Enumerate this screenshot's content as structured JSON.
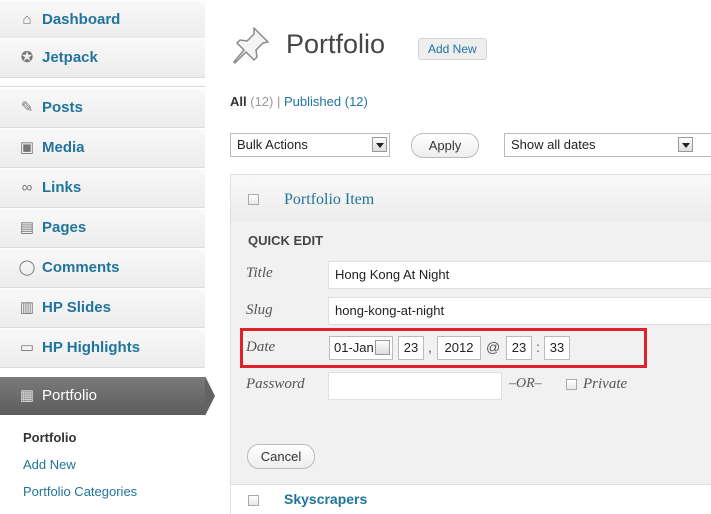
{
  "sidebar": {
    "items": [
      {
        "label": "Dashboard",
        "icon": "home-icon"
      },
      {
        "label": "Jetpack",
        "icon": "jetpack-icon"
      },
      {
        "label": "Posts",
        "icon": "pin-icon"
      },
      {
        "label": "Media",
        "icon": "media-icon"
      },
      {
        "label": "Links",
        "icon": "link-icon"
      },
      {
        "label": "Pages",
        "icon": "pages-icon"
      },
      {
        "label": "Comments",
        "icon": "comment-icon"
      },
      {
        "label": "HP Slides",
        "icon": "slides-icon"
      },
      {
        "label": "HP Highlights",
        "icon": "highlights-icon"
      },
      {
        "label": "Portfolio",
        "icon": "portfolio-icon"
      }
    ],
    "submenu": [
      "Portfolio",
      "Add New",
      "Portfolio Categories"
    ]
  },
  "header": {
    "title": "Portfolio",
    "add_new": "Add New"
  },
  "filters": {
    "all_label": "All",
    "all_count": "(12)",
    "separator": "|",
    "published_label": "Published",
    "published_count": "(12)",
    "bulk_actions": "Bulk Actions",
    "apply": "Apply",
    "dates": "Show all dates"
  },
  "table": {
    "column_title": "Portfolio Item"
  },
  "quick_edit": {
    "heading": "QUICK EDIT",
    "title_label": "Title",
    "title_value": "Hong Kong At Night",
    "slug_label": "Slug",
    "slug_value": "hong-kong-at-night",
    "date_label": "Date",
    "month": "01-Jan",
    "day": "23",
    "comma": ",",
    "year": "2012",
    "at": "@",
    "hour": "23",
    "colon": ":",
    "minute": "33",
    "password_label": "Password",
    "or_label": "–OR–",
    "private_label": "Private",
    "cancel": "Cancel"
  },
  "rows": [
    {
      "title": "Skyscrapers"
    }
  ],
  "colors": {
    "link": "#21759b",
    "highlight": "#e0202a",
    "menu_active": "#636363"
  }
}
